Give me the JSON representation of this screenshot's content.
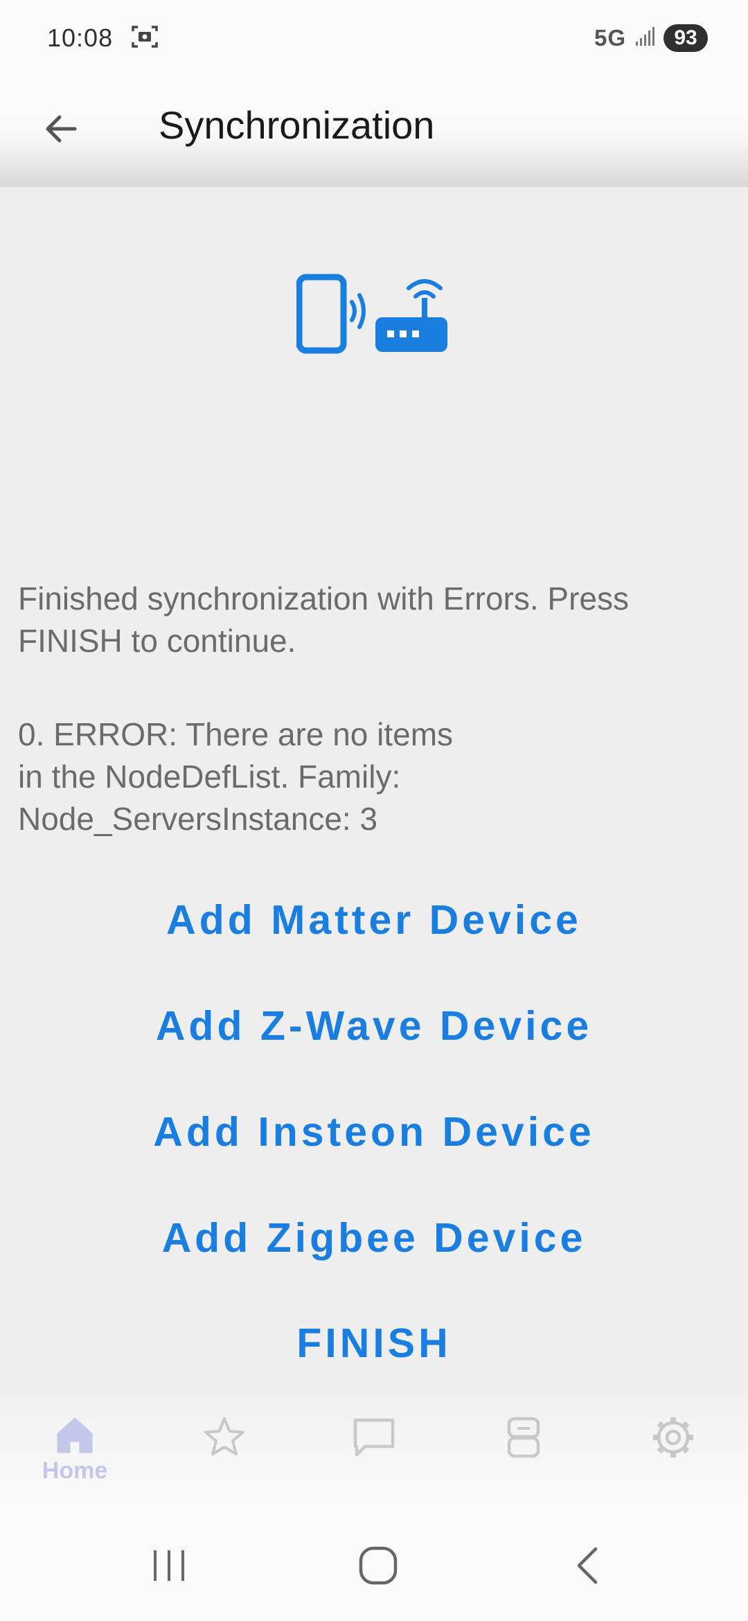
{
  "status_bar": {
    "time": "10:08",
    "network": "5G",
    "battery": "93",
    "icons": [
      "screenshot-icon",
      "signal-icon",
      "battery-icon"
    ]
  },
  "app_bar": {
    "title": "Synchronization",
    "back_icon": "arrow-left-icon"
  },
  "main": {
    "hero_icon": "phone-to-router-icon",
    "finish_message": "Finished synchronization with Errors. Press FINISH to continue.",
    "error_message": "0. ERROR: There are no items\nin the NodeDefList. Family:\nNode_ServersInstance: 3",
    "buttons": {
      "matter": "Add Matter Device",
      "zwave": "Add Z-Wave Device",
      "insteon": "Add Insteon Device",
      "zigbee": "Add Zigbee Device",
      "finish": "FINISH"
    }
  },
  "bottom_nav": {
    "items": [
      {
        "label": "Home",
        "icon": "home-icon",
        "active": true
      },
      {
        "label": "",
        "icon": "star-icon"
      },
      {
        "label": "",
        "icon": "chat-icon"
      },
      {
        "label": "",
        "icon": "device-icon"
      },
      {
        "label": "",
        "icon": "gear-icon"
      }
    ]
  },
  "system_nav": {
    "icons": [
      "recent-apps-icon",
      "home-button-icon",
      "back-button-icon"
    ]
  },
  "colors": {
    "accent": "#1a7de0",
    "background": "#eeeeee",
    "text": "#6b6b6b",
    "nav_active": "#c4c6ea",
    "nav_inactive": "#c8c8c8"
  }
}
